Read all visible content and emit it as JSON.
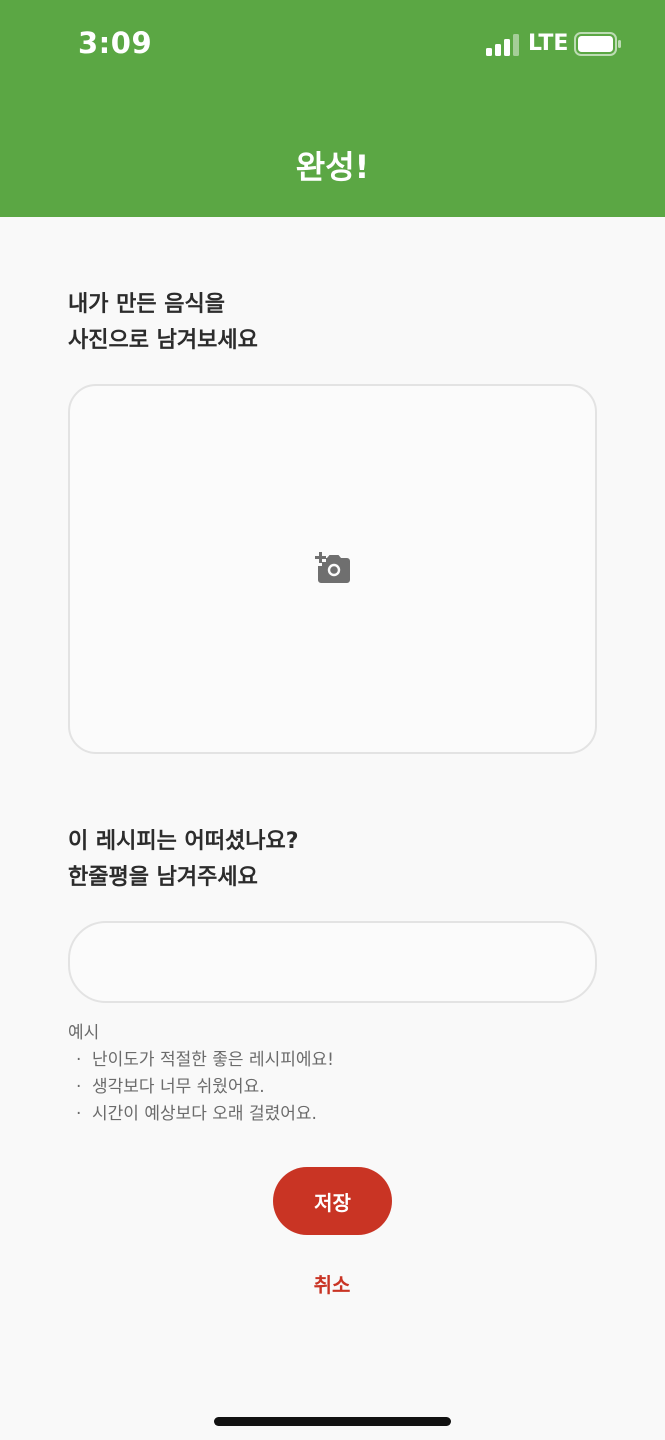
{
  "status_bar": {
    "time": "3:09",
    "network": "LTE",
    "icons": [
      "signal-icon",
      "battery-icon"
    ]
  },
  "header": {
    "title": "완성!",
    "background_color": "#5ba744"
  },
  "photo_section": {
    "label_line1": "내가 만든 음식을",
    "label_line2": "사진으로 남겨보세요",
    "icon": "add-photo-camera-icon"
  },
  "review_section": {
    "label_line1": "이 레시피는 어떠셨나요?",
    "label_line2": "한줄평을 남겨주세요",
    "input_value": "",
    "input_placeholder": ""
  },
  "examples": {
    "title": "예시",
    "items": [
      "난이도가 적절한 좋은 레시피에요!",
      "생각보다 너무 쉬웠어요.",
      "시간이 예상보다 오래 걸렸어요."
    ]
  },
  "actions": {
    "save_label": "저장",
    "cancel_label": "취소",
    "accent_color": "#c93424"
  }
}
